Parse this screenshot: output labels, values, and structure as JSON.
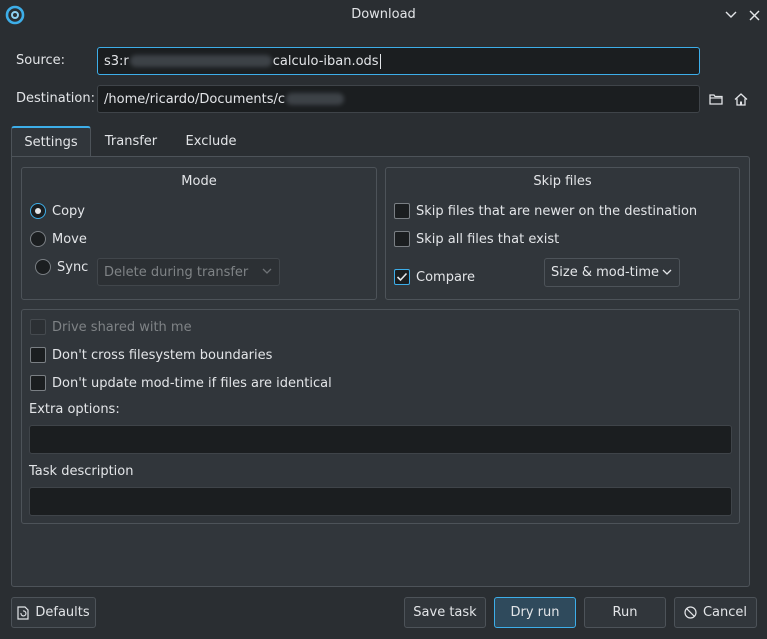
{
  "window": {
    "title": "Download",
    "buttons": [
      "minimize",
      "close"
    ]
  },
  "source": {
    "label": "Source:",
    "value_prefix": "s3:r",
    "value_suffix": "calculo-iban.ods"
  },
  "destination": {
    "label": "Destination:",
    "value_prefix": "/home/ricardo/Documents/c"
  },
  "tabs": [
    {
      "label": "Settings",
      "active": true
    },
    {
      "label": "Transfer",
      "active": false
    },
    {
      "label": "Exclude",
      "active": false
    }
  ],
  "mode": {
    "title": "Mode",
    "options": [
      "Copy",
      "Move",
      "Sync"
    ],
    "selected": "Copy",
    "sync_select": "Delete during transfer"
  },
  "skip": {
    "title": "Skip files",
    "newer_label": "Skip files that are newer on the destination",
    "exist_label": "Skip all files that exist",
    "compare_label": "Compare",
    "compare_checked": true,
    "compare_select": "Size & mod-time"
  },
  "options": {
    "shared_label": "Drive shared with me",
    "shared_disabled": true,
    "cross_fs_label": "Don't cross filesystem boundaries",
    "mod_time_label": "Don't update mod-time if files are identical",
    "extra_label": "Extra options:",
    "extra_value": "",
    "task_desc_label": "Task description",
    "task_desc_value": ""
  },
  "buttons": {
    "defaults": "Defaults",
    "save_task": "Save task",
    "dry_run": "Dry run",
    "run": "Run",
    "cancel": "Cancel"
  },
  "colors": {
    "accent": "#3daee9",
    "background": "#2a2e32",
    "panel": "#31363b",
    "field": "#1b1e20"
  }
}
